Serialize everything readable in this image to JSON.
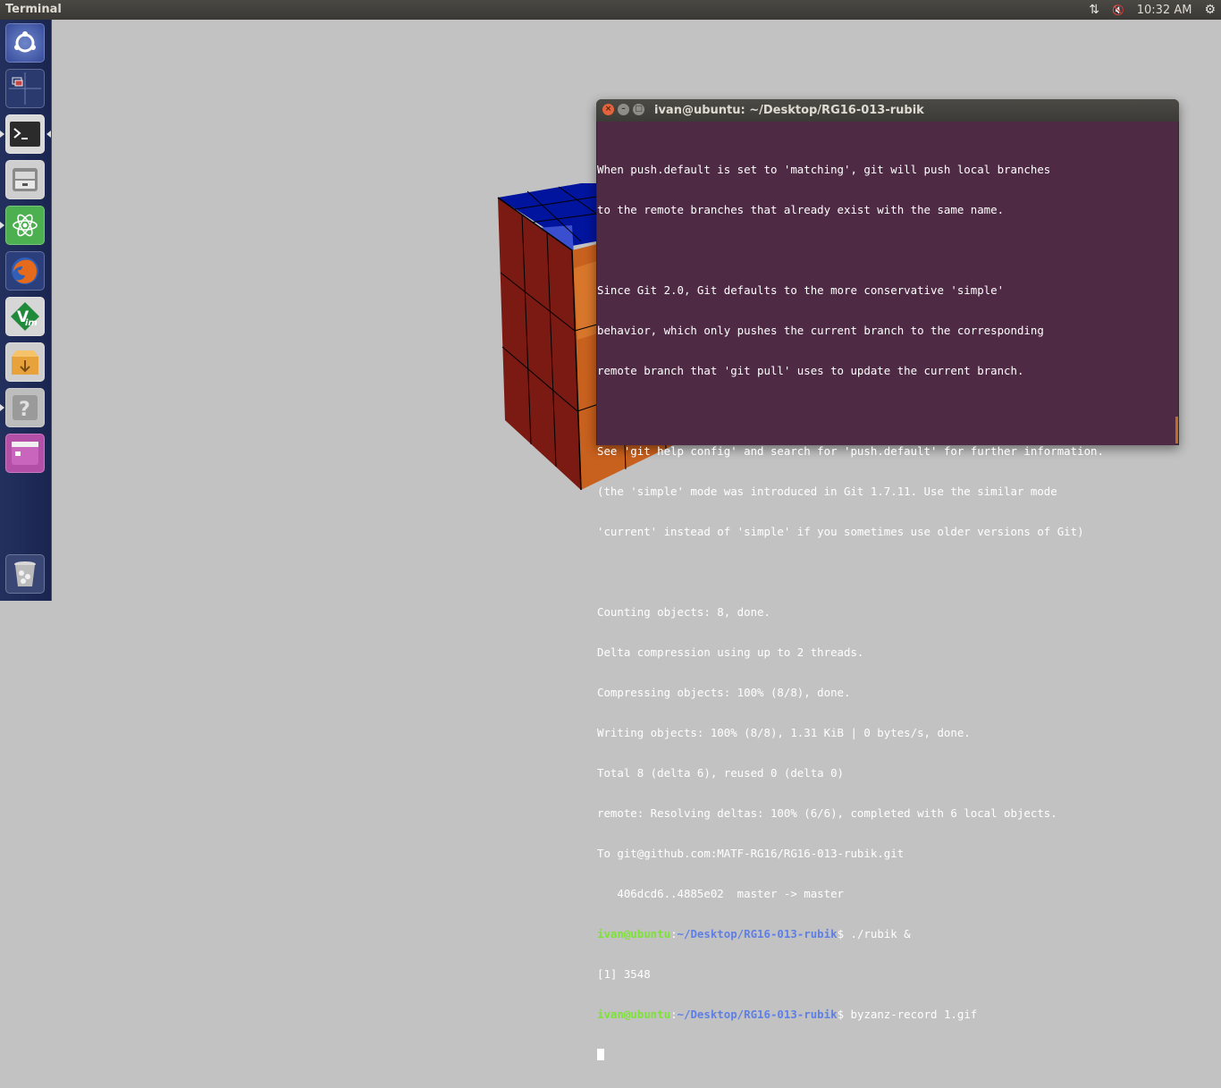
{
  "top_panel": {
    "app_title": "Terminal",
    "clock": "10:32 AM"
  },
  "launcher": {
    "items": [
      {
        "name": "dash-home"
      },
      {
        "name": "workspace-switcher"
      },
      {
        "name": "terminal"
      },
      {
        "name": "files"
      },
      {
        "name": "atom"
      },
      {
        "name": "firefox"
      },
      {
        "name": "vim"
      },
      {
        "name": "archive-manager"
      },
      {
        "name": "help"
      },
      {
        "name": "app"
      },
      {
        "name": "trash"
      }
    ]
  },
  "terminal_window": {
    "title": "ivan@ubuntu: ~/Desktop/RG16-013-rubik",
    "lines": [
      "When push.default is set to 'matching', git will push local branches",
      "to the remote branches that already exist with the same name.",
      "",
      "Since Git 2.0, Git defaults to the more conservative 'simple'",
      "behavior, which only pushes the current branch to the corresponding",
      "remote branch that 'git pull' uses to update the current branch.",
      "",
      "See 'git help config' and search for 'push.default' for further information.",
      "(the 'simple' mode was introduced in Git 1.7.11. Use the similar mode",
      "'current' instead of 'simple' if you sometimes use older versions of Git)",
      "",
      "Counting objects: 8, done.",
      "Delta compression using up to 2 threads.",
      "Compressing objects: 100% (8/8), done.",
      "Writing objects: 100% (8/8), 1.31 KiB | 0 bytes/s, done.",
      "Total 8 (delta 6), reused 0 (delta 0)",
      "remote: Resolving deltas: 100% (6/6), completed with 6 local objects.",
      "To git@github.com:MATF-RG16/RG16-013-rubik.git",
      "   406dcd6..4885e02  master -> master"
    ],
    "prompt_user": "ivan@ubuntu",
    "prompt_sep": ":",
    "prompt_path": "~/Desktop/RG16-013-rubik",
    "prompt_symbol": "$",
    "cmd1": " ./rubik &",
    "job_line": "[1] 3548",
    "cmd2": " byzanz-record 1.gif"
  },
  "colors": {
    "terminal_bg": "#4f2a44",
    "prompt_user": "#7ee13a",
    "prompt_path": "#5d7fe6",
    "launcher_bg": "#1f2b58",
    "desktop_bg": "#c2c2c2"
  }
}
